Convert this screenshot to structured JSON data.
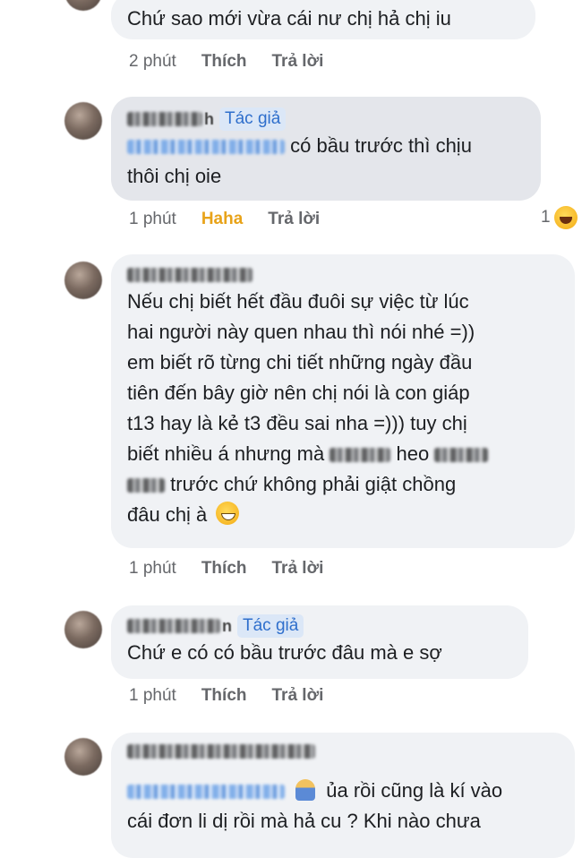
{
  "comments": [
    {
      "text": "Chứ sao mới vừa cái nư chị hả chị iu",
      "time": "2 phút",
      "like": "Thích",
      "reply": "Trả lời"
    },
    {
      "name_visible": "h",
      "badge": "Tác giả",
      "text_line1": "có bầu trước thì chịu",
      "text_line2": "thôi chị oie",
      "time": "1 phút",
      "like": "Haha",
      "reply": "Trả lời",
      "reaction_count": "1"
    },
    {
      "lines": [
        "Nếu chị biết hết đầu đuôi sự việc từ lúc",
        "hai người này quen nhau thì nói nhé =))",
        "em biết rõ từng chi tiết những ngày đầu",
        "tiên đến bây giờ nên chị nói là con giáp",
        "t13 hay là kẻ t3 đều sai nha =))) tuy chị"
      ],
      "line6_a": "biết nhiều á nhưng mà",
      "line6_b": "heo",
      "line7": "trước chứ không phải giật chồng",
      "line8": "đâu chị à",
      "time": "1 phút",
      "like": "Thích",
      "reply": "Trả lời"
    },
    {
      "name_visible": "n",
      "badge": "Tác giả",
      "text": "Chứ e có có bầu trước đâu mà e sợ",
      "time": "1 phút",
      "like": "Thích",
      "reply": "Trả lời"
    },
    {
      "text_line1": "ủa rồi cũng là kí vào",
      "text_line2": "cái đơn li dị rồi mà hả cu ? Khi nào chưa"
    }
  ],
  "colors": {
    "bubble": "#f0f2f5",
    "badge_bg": "#dbe7f7",
    "badge_text": "#2f6fcc",
    "haha": "#e8a319",
    "meta": "#65676b"
  }
}
